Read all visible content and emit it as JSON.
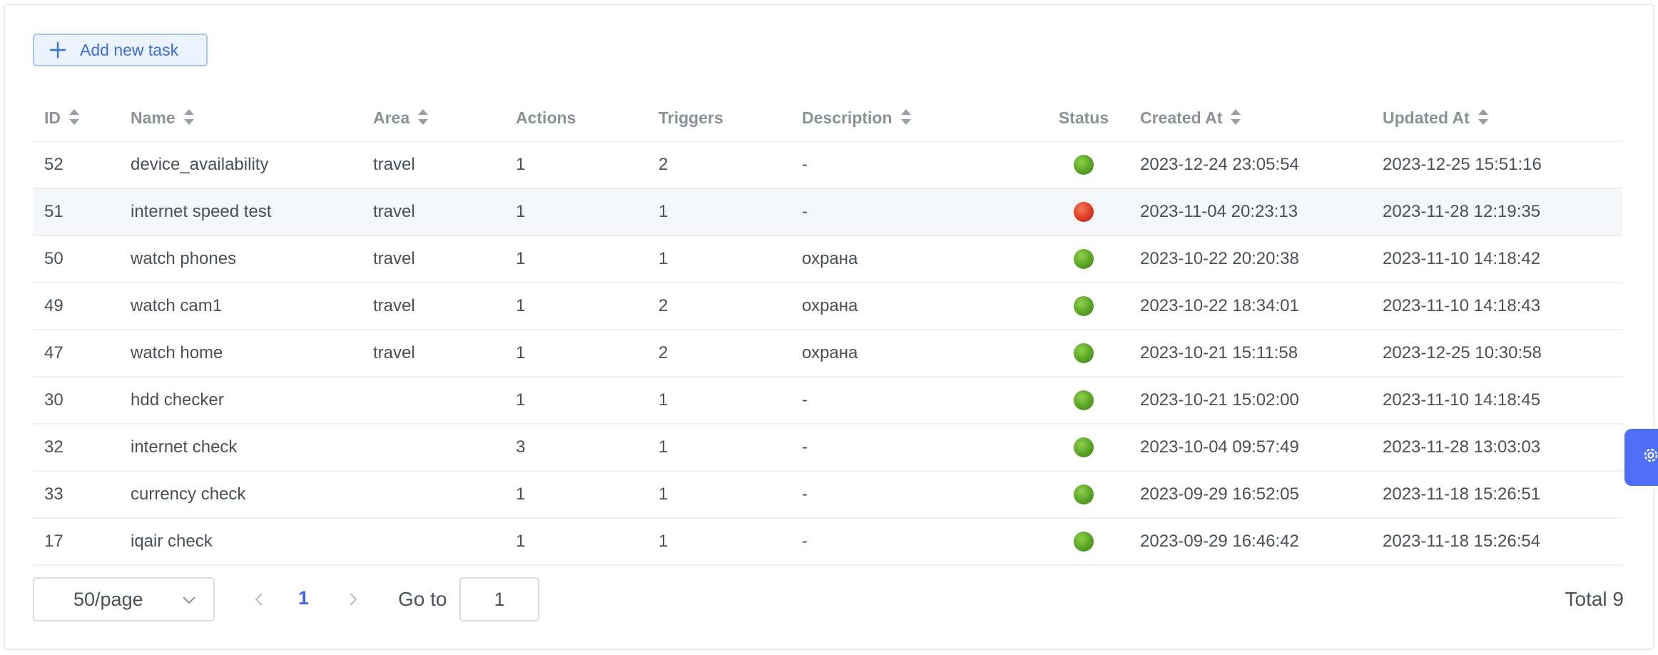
{
  "toolbar": {
    "add_label": "Add new task"
  },
  "table": {
    "columns": {
      "id": "ID",
      "name": "Name",
      "area": "Area",
      "actions": "Actions",
      "triggers": "Triggers",
      "description": "Description",
      "status": "Status",
      "created": "Created At",
      "updated": "Updated At"
    },
    "rows": [
      {
        "id": "52",
        "name": "device_availability",
        "area": "travel",
        "actions": "1",
        "triggers": "2",
        "description": "-",
        "status": "green",
        "created": "2023-12-24 23:05:54",
        "updated": "2023-12-25 15:51:16"
      },
      {
        "id": "51",
        "name": "internet speed test",
        "area": "travel",
        "actions": "1",
        "triggers": "1",
        "description": "-",
        "status": "red",
        "created": "2023-11-04 20:23:13",
        "updated": "2023-11-28 12:19:35"
      },
      {
        "id": "50",
        "name": "watch phones",
        "area": "travel",
        "actions": "1",
        "triggers": "1",
        "description": "охрана",
        "status": "green",
        "created": "2023-10-22 20:20:38",
        "updated": "2023-11-10 14:18:42"
      },
      {
        "id": "49",
        "name": "watch cam1",
        "area": "travel",
        "actions": "1",
        "triggers": "2",
        "description": "охрана",
        "status": "green",
        "created": "2023-10-22 18:34:01",
        "updated": "2023-11-10 14:18:43"
      },
      {
        "id": "47",
        "name": "watch home",
        "area": "travel",
        "actions": "1",
        "triggers": "2",
        "description": "охрана",
        "status": "green",
        "created": "2023-10-21 15:11:58",
        "updated": "2023-12-25 10:30:58"
      },
      {
        "id": "30",
        "name": "hdd checker",
        "area": "",
        "actions": "1",
        "triggers": "1",
        "description": "-",
        "status": "green",
        "created": "2023-10-21 15:02:00",
        "updated": "2023-11-10 14:18:45"
      },
      {
        "id": "32",
        "name": "internet check",
        "area": "",
        "actions": "3",
        "triggers": "1",
        "description": "-",
        "status": "green",
        "created": "2023-10-04 09:57:49",
        "updated": "2023-11-28 13:03:03"
      },
      {
        "id": "33",
        "name": "currency check",
        "area": "",
        "actions": "1",
        "triggers": "1",
        "description": "-",
        "status": "green",
        "created": "2023-09-29 16:52:05",
        "updated": "2023-11-18 15:26:51"
      },
      {
        "id": "17",
        "name": "iqair check",
        "area": "",
        "actions": "1",
        "triggers": "1",
        "description": "-",
        "status": "green",
        "created": "2023-09-29 16:46:42",
        "updated": "2023-11-18 15:26:54"
      }
    ]
  },
  "pagination": {
    "page_size": "50/page",
    "current_page": "1",
    "goto_label": "Go to",
    "goto_value": "1",
    "total": "Total 9"
  },
  "icons": {
    "add": "plus-icon",
    "sort": "sort-icon",
    "dropdown": "chevron-down-icon",
    "prev": "chevron-left-icon",
    "next": "chevron-right-icon",
    "settings": "gear-icon"
  },
  "colors": {
    "accent": "#3d66d4",
    "status_green": "#58a324",
    "status_red": "#e03a25",
    "settings_tab": "#4f6ef7"
  }
}
